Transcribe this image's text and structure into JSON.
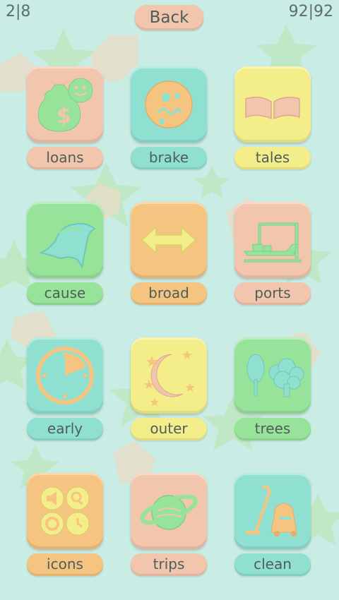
{
  "header": {
    "level_progress": "2|8",
    "score": "92|92",
    "back_label": "Back"
  },
  "colors": {
    "background": "#c9ece4",
    "peach": "#f2c5ad",
    "aqua": "#8fe0d0",
    "yellow": "#f4ee8a",
    "green": "#97e39a",
    "orange": "#f5c480",
    "text": "#4f5e5a"
  },
  "tiles": [
    {
      "label": "loans",
      "icon": "money-bag-smiley-icon",
      "tile_color": "peach",
      "label_color": "peach"
    },
    {
      "label": "brake",
      "icon": "broken-face-icon",
      "tile_color": "aqua",
      "label_color": "aqua"
    },
    {
      "label": "tales",
      "icon": "open-book-icon",
      "tile_color": "yellow",
      "label_color": "yellow"
    },
    {
      "label": "cause",
      "icon": "flying-cape-icon",
      "tile_color": "green",
      "label_color": "green"
    },
    {
      "label": "broad",
      "icon": "double-arrow-icon",
      "tile_color": "orange",
      "label_color": "orange"
    },
    {
      "label": "ports",
      "icon": "ship-crane-icon",
      "tile_color": "peach",
      "label_color": "peach"
    },
    {
      "label": "early",
      "icon": "clock-icon",
      "tile_color": "aqua",
      "label_color": "aqua"
    },
    {
      "label": "outer",
      "icon": "moon-stars-icon",
      "tile_color": "yellow",
      "label_color": "yellow"
    },
    {
      "label": "trees",
      "icon": "trees-icon",
      "tile_color": "green",
      "label_color": "green"
    },
    {
      "label": "icons",
      "icon": "app-icons-grid-icon",
      "tile_color": "orange",
      "label_color": "orange"
    },
    {
      "label": "trips",
      "icon": "saturn-planet-icon",
      "tile_color": "peach",
      "label_color": "peach"
    },
    {
      "label": "clean",
      "icon": "vacuum-cleaner-icon",
      "tile_color": "aqua",
      "label_color": "aqua"
    }
  ]
}
